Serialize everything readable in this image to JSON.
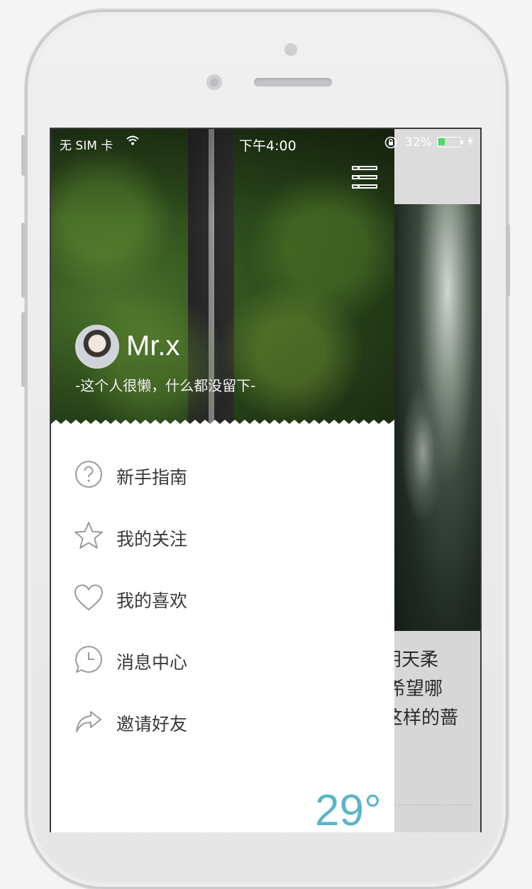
{
  "status_bar": {
    "carrier": "无 SIM 卡",
    "time": "下午4:00",
    "battery": "32%",
    "battery_level": 0.32,
    "battery_color": "#4cd964"
  },
  "drawer": {
    "menu_icon": "list-menu-icon",
    "user": {
      "name": "Mr.x",
      "signature": "-这个人很懒，什么都没留下-"
    },
    "menu": [
      {
        "label": "新手指南",
        "icon": "question-circle-icon"
      },
      {
        "label": "我的关注",
        "icon": "star-icon"
      },
      {
        "label": "我的喜欢",
        "icon": "heart-icon"
      },
      {
        "label": "消息中心",
        "icon": "clock-bubble-icon"
      },
      {
        "label": "邀请好友",
        "icon": "share-arrow-icon"
      }
    ],
    "weather": {
      "temperature": "29°",
      "color": "#5bb6c9"
    }
  },
  "background_content": {
    "text_lines": [
      "阴天柔",
      "希望哪",
      "这样的蔷"
    ]
  }
}
